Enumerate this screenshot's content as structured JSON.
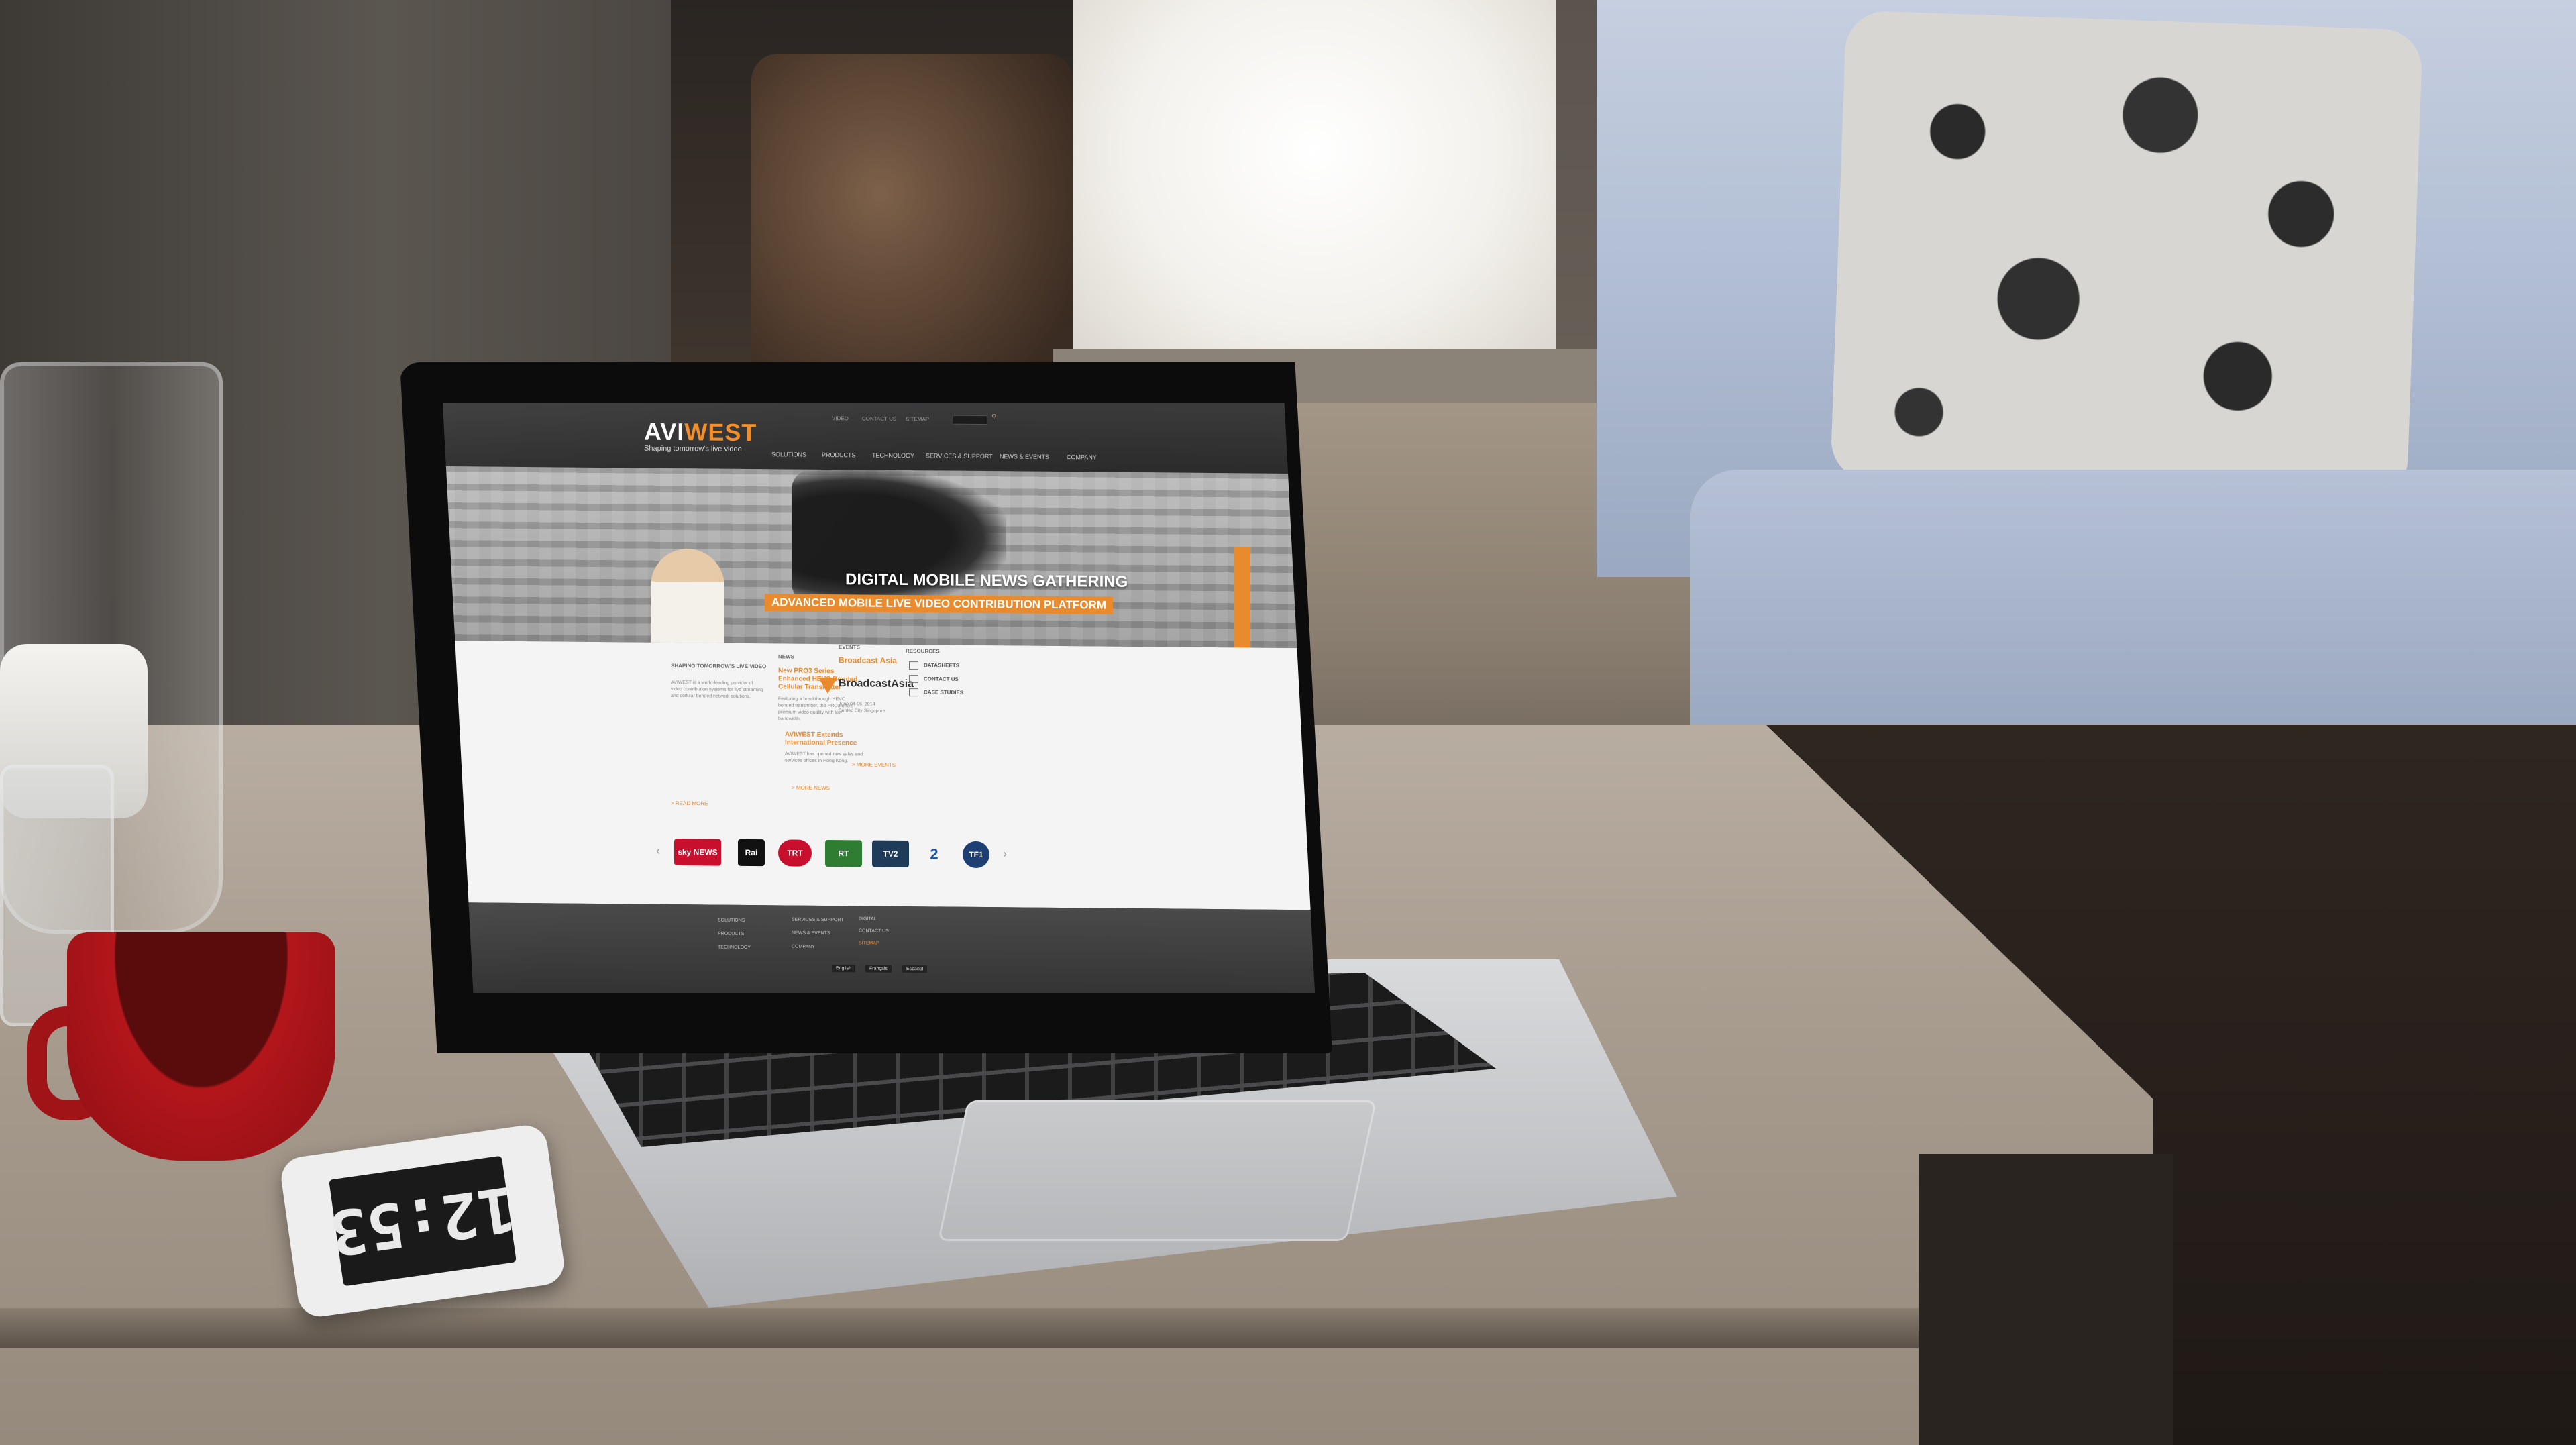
{
  "phone": {
    "time": "12:53"
  },
  "site": {
    "logo_main": "AVI",
    "logo_accent": "WEST",
    "tagline": "Shaping tomorrow's live video",
    "util_nav": [
      "VIDEO",
      "CONTACT US",
      "SITEMAP"
    ],
    "main_nav": [
      "SOLUTIONS",
      "PRODUCTS",
      "TECHNOLOGY",
      "SERVICES & SUPPORT",
      "NEWS & EVENTS",
      "COMPANY"
    ],
    "hero": {
      "title": "DIGITAL MOBILE NEWS GATHERING",
      "subtitle": "ADVANCED MOBILE LIVE VIDEO CONTRIBUTION PLATFORM"
    },
    "about": {
      "heading": "SHAPING TOMORROW'S LIVE VIDEO",
      "text": "AVIWEST is a world-leading provider of video contribution systems for live streaming and cellular bonded network solutions.",
      "read_more": "> READ MORE"
    },
    "news": {
      "heading": "NEWS",
      "items": [
        {
          "title": "New PRO3 Series Enhanced HEVC Bonded Cellular Transmitter",
          "text": "Featuring a breakthrough HEVC bonded transmitter, the PRO3 offers premium video quality with low bandwidth."
        },
        {
          "title": "AVIWEST Extends International Presence",
          "text": "AVIWEST has opened new sales and services offices in Hong Kong."
        }
      ],
      "more": "> MORE NEWS"
    },
    "events": {
      "heading": "EVENTS",
      "title": "Broadcast Asia",
      "logo": "BroadcastAsia",
      "text": "June 04-06, 2014 Suntec City Singapore",
      "more": "> MORE EVENTS"
    },
    "resources": {
      "heading": "RESOURCES",
      "items": [
        "DATASHEETS",
        "CONTACT US",
        "CASE STUDIES"
      ]
    },
    "partners": [
      "sky NEWS",
      "Rai",
      "TRT",
      "RT",
      "TV2",
      "2",
      "TF1"
    ],
    "footer": {
      "col1": [
        "SOLUTIONS",
        "PRODUCTS",
        "TECHNOLOGY"
      ],
      "col2": [
        "SERVICES & SUPPORT",
        "NEWS & EVENTS",
        "COMPANY"
      ],
      "col3": [
        "DIGITAL",
        "CONTACT US",
        "SITEMAP"
      ],
      "langs": [
        "English",
        "Français",
        "Español"
      ]
    }
  },
  "colors": {
    "accent": "#e98a2c",
    "mug": "#b3161b"
  }
}
